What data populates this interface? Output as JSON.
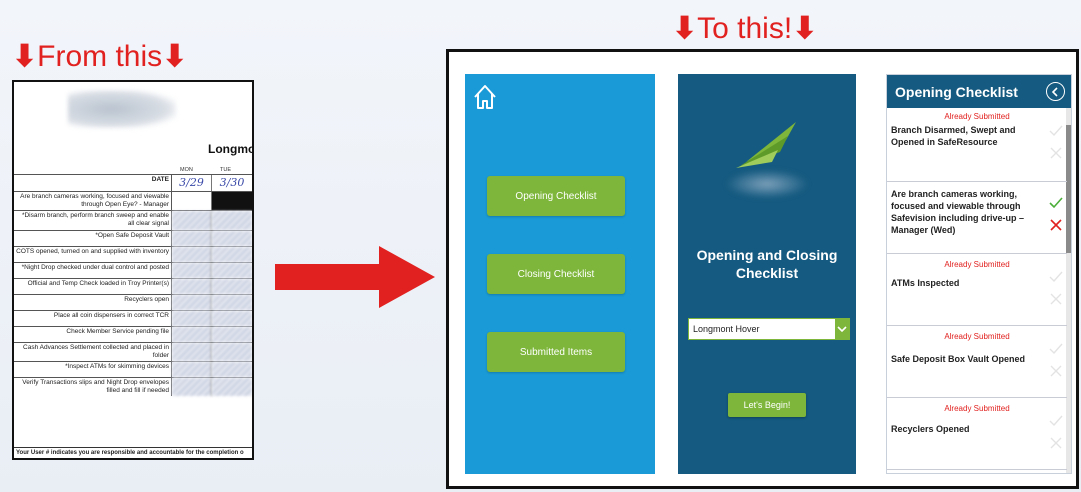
{
  "headings": {
    "from": {
      "arrow_left": "⬇",
      "text": "From this",
      "arrow_right": "⬇"
    },
    "to": {
      "arrow_left": "⬇",
      "text": "To this!",
      "arrow_right": "⬇"
    }
  },
  "paper_form": {
    "branch": "Longmo",
    "day_mon": "MON",
    "day_tue": "TUE",
    "date_label": "DATE",
    "date_mon": "3/29",
    "date_tue": "3/30",
    "rows": [
      "Are branch cameras working, focused and viewable through Open Eye? - Manager",
      "*Disarm branch, perform branch sweep and enable all clear signal",
      "*Open Safe Deposit Vault",
      "COTS opened, turned on and supplied with inventory",
      "*Night Drop checked under dual control and posted",
      "Official and Temp Check loaded in Troy Printer(s)",
      "Recyclers open",
      "Place all coin dispensers in correct TCR",
      "Check Member Service pending file",
      "Cash Advances Settlement collected and placed in folder",
      "*Inspect ATMs for skimming devices",
      "Verify Transactions slips and Night Drop envelopes filled and fill if needed"
    ],
    "footer": "Your User # indicates you are responsible and accountable for the completion o"
  },
  "home_panel": {
    "buttons": [
      "Opening Checklist",
      "Closing Checklist",
      "Submitted Items"
    ]
  },
  "start_panel": {
    "title_line1": "Opening and Closing",
    "title_line2": "Checklist",
    "branch_selected": "Longmont Hover",
    "begin_label": "Let's Begin!"
  },
  "list_panel": {
    "title": "Opening Checklist",
    "items": [
      {
        "status": "Already Submitted",
        "label": "Branch Disarmed, Swept and Opened in SafeResource"
      },
      {
        "status": "",
        "label": "Are branch cameras working, focused and viewable through Safevision including drive-up – Manager (Wed)"
      },
      {
        "status": "Already Submitted",
        "label": "ATMs Inspected"
      },
      {
        "status": "Already Submitted",
        "label": "Safe Deposit Box Vault Opened"
      },
      {
        "status": "Already Submitted",
        "label": "Recyclers Opened"
      }
    ]
  },
  "colors": {
    "accent_red": "#e1211f",
    "home_blue": "#1a9ad6",
    "dark_blue": "#155a80",
    "green": "#7db63a"
  },
  "icons": [
    "home-icon",
    "chevron-down-icon",
    "back-arrow-icon",
    "check-icon",
    "x-icon",
    "red-arrow-icon"
  ]
}
